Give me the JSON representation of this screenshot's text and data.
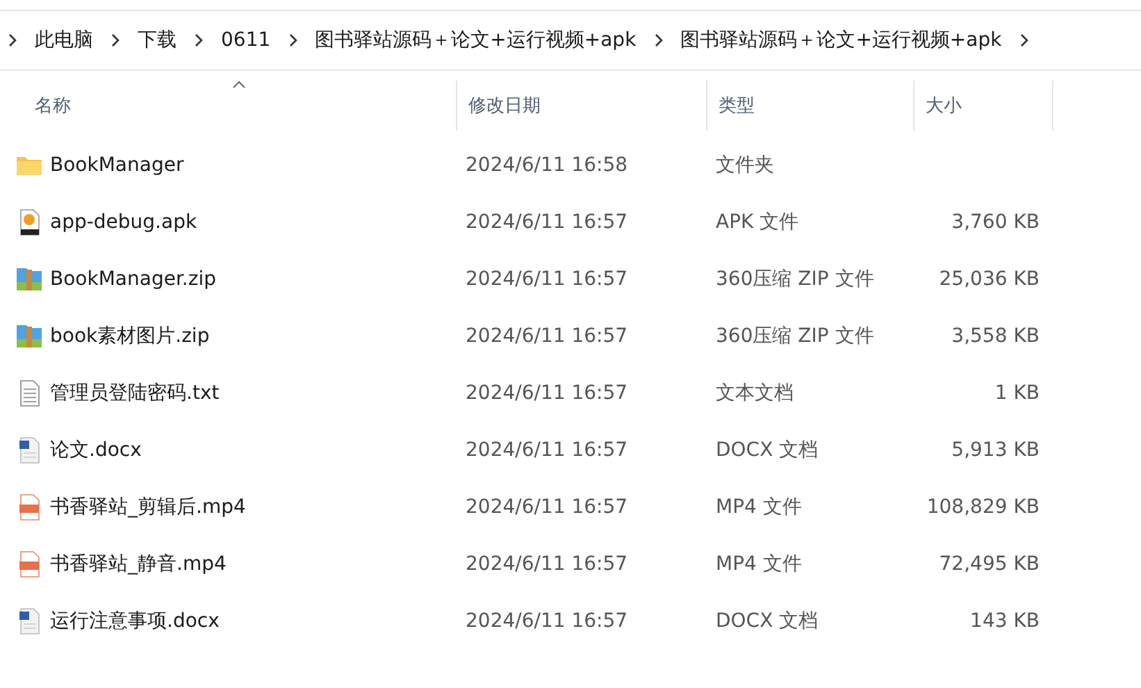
{
  "breadcrumb": [
    "此电脑",
    "下载",
    "0611",
    "图书驿站源码＋论文+运行视频+apk",
    "图书驿站源码＋论文+运行视频+apk"
  ],
  "columns": [
    {
      "label": "名称",
      "sorted": true
    },
    {
      "label": "修改日期",
      "sorted": false
    },
    {
      "label": "类型",
      "sorted": false
    },
    {
      "label": "大小",
      "sorted": false
    }
  ],
  "rows": [
    {
      "kind": "folder",
      "name": "BookManager",
      "date": "2024/6/11 16:58",
      "type": "文件夹"
    },
    {
      "kind": "apk",
      "name": "app-debug.apk",
      "date": "2024/6/11 16:57",
      "type": "APK 文件",
      "size": "3,760 KB"
    },
    {
      "kind": "zip",
      "name": "BookManager.zip",
      "date": "2024/6/11 16:57",
      "type": "360压缩 ZIP 文件",
      "size": "25,036 KB"
    },
    {
      "kind": "zip",
      "name": "book素材图片.zip",
      "date": "2024/6/11 16:57",
      "type": "360压缩 ZIP 文件",
      "size": "3,558 KB"
    },
    {
      "kind": "txt",
      "name": "管理员登陆密码.txt",
      "date": "2024/6/11 16:57",
      "type": "文本文档",
      "size": "1 KB"
    },
    {
      "kind": "docx",
      "name": "论文.docx",
      "date": "2024/6/11 16:57",
      "type": "DOCX 文档",
      "size": "5,913 KB"
    },
    {
      "kind": "mp4",
      "name": "书香驿站_剪辑后.mp4",
      "date": "2024/6/11 16:57",
      "type": "MP4 文件",
      "size": "108,829 KB"
    },
    {
      "kind": "mp4",
      "name": "书香驿站_静音.mp4",
      "date": "2024/6/11 16:57",
      "type": "MP4 文件",
      "size": "72,495 KB"
    },
    {
      "kind": "docx",
      "name": "运行注意事项.docx",
      "date": "2024/6/11 16:57",
      "type": "DOCX 文档",
      "size": "143 KB"
    }
  ]
}
